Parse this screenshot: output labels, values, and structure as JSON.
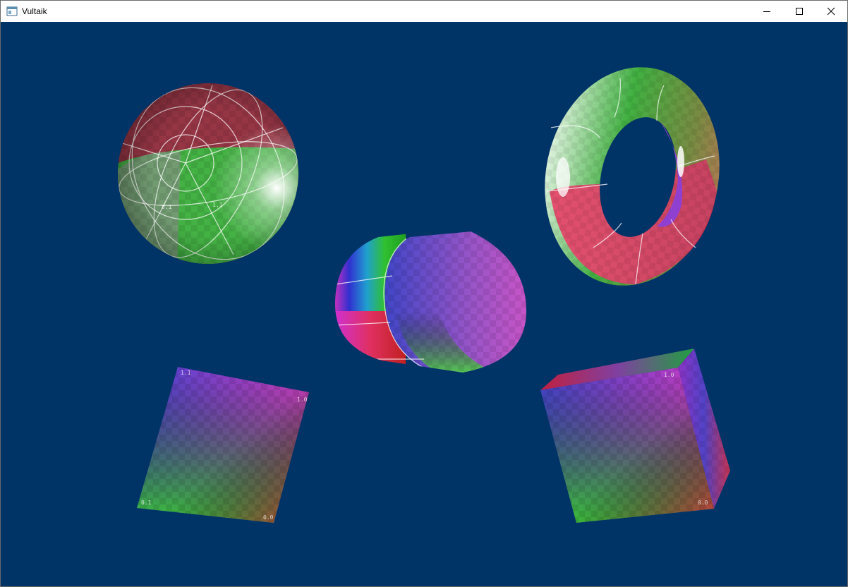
{
  "window": {
    "title": "Vultaik",
    "buttons": {
      "minimize": "minimize-icon",
      "maximize": "maximize-icon",
      "close": "close-icon"
    }
  },
  "scene": {
    "background": "#003366",
    "objects": [
      "sphere",
      "torus",
      "capsule",
      "plane",
      "cube"
    ],
    "uv_labels": {
      "origin": "0.0",
      "u_max": "1.0",
      "v_max": "0.1",
      "corner": "1.1"
    }
  }
}
